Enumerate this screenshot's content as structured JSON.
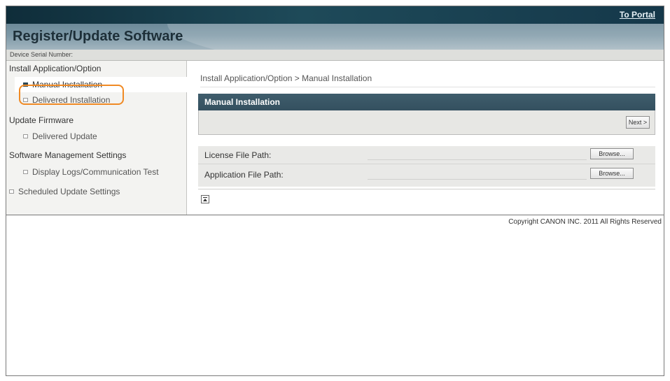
{
  "header": {
    "to_portal": "To Portal",
    "title": "Register/Update Software",
    "serial_label": "Device Serial Number:"
  },
  "sidebar": {
    "categories": [
      "Install Application/Option",
      "Update Firmware",
      "Software Management Settings"
    ],
    "items": [
      "Manual Installation",
      "Delivered Installation",
      "Delivered Update",
      "Display Logs/Communication Test",
      "Scheduled Update Settings"
    ]
  },
  "main": {
    "breadcrumb": "Install Application/Option > Manual Installation",
    "panel_title": "Manual Installation",
    "next_label": "Next >",
    "form": {
      "license_label": "License File Path:",
      "application_label": "Application File Path:",
      "browse_label": "Browse...",
      "license_value": "",
      "application_value": ""
    }
  },
  "footer": {
    "copyright": "Copyright CANON INC. 2011 All Rights Reserved"
  },
  "colors": {
    "header_dark": "#1e4a59",
    "panel_header": "#3f5d6c",
    "highlight": "#f08a24"
  },
  "icons": {
    "selected_bullet": "square-filled-icon",
    "bullet": "square-icon",
    "top": "back-to-top-icon"
  }
}
